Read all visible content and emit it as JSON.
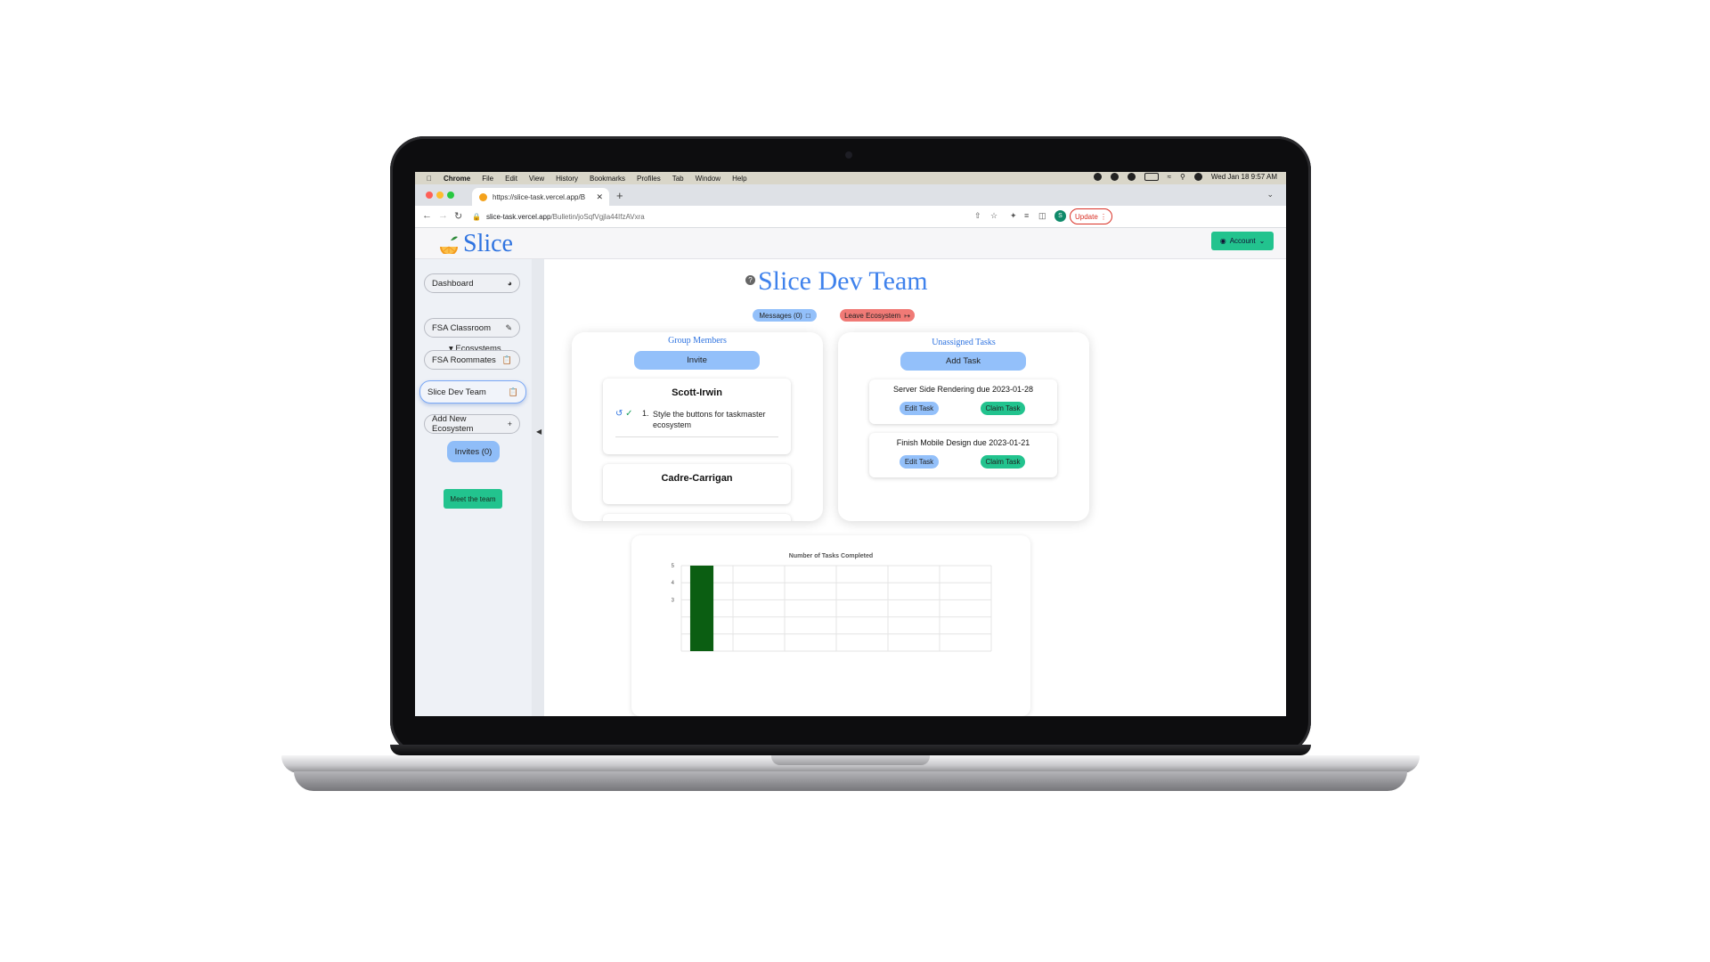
{
  "menubar": {
    "apple": "",
    "items": [
      "Chrome",
      "File",
      "Edit",
      "View",
      "History",
      "Bookmarks",
      "Profiles",
      "Tab",
      "Window",
      "Help"
    ],
    "clock": "Wed Jan 18  9:57 AM"
  },
  "browser": {
    "tab_title": "https://slice-task.vercel.app/B",
    "url_domain": "slice-task.vercel.app",
    "url_path": "/Bulletin/joSqfVgjla44IfzAVxra",
    "profile_initial": "S",
    "update_label": "Update"
  },
  "app": {
    "logo": "Slice",
    "account_label": "Account"
  },
  "sidebar": {
    "dashboard": "Dashboard",
    "ecosystems_label": "Ecosystems",
    "items": [
      "FSA Classroom",
      "FSA Roommates",
      "Slice Dev Team"
    ],
    "add_new": "Add New Ecosystem",
    "invites": "Invites (0)",
    "meet_team": "Meet the team"
  },
  "main": {
    "title": "Slice Dev Team",
    "messages_label": "Messages (0)",
    "leave_label": "Leave Ecosystem",
    "group_members": {
      "title": "Group Members",
      "invite_label": "Invite",
      "members": [
        {
          "name": "Scott-Irwin",
          "tasks": [
            {
              "num": "1.",
              "text": "Style the buttons for taskmaster ecosystem"
            }
          ]
        },
        {
          "name": "Cadre-Carrigan",
          "tasks": []
        }
      ]
    },
    "unassigned": {
      "title": "Unassigned Tasks",
      "add_label": "Add Task",
      "edit_label": "Edit Task",
      "claim_label": "Claim Task",
      "tasks": [
        "Server Side Rendering due 2023-01-28",
        "Finish Mobile Design due 2023-01-21"
      ]
    }
  },
  "chart_data": {
    "type": "bar",
    "title": "Number of Tasks Completed",
    "ylim": [
      0,
      5
    ],
    "y_ticks": [
      "5",
      "4",
      "3"
    ],
    "categories": [
      "",
      "",
      "",
      "",
      "",
      ""
    ],
    "values": [
      5,
      0,
      0,
      0,
      0,
      0
    ],
    "colors": {
      "bar": "#0b5e12"
    }
  }
}
